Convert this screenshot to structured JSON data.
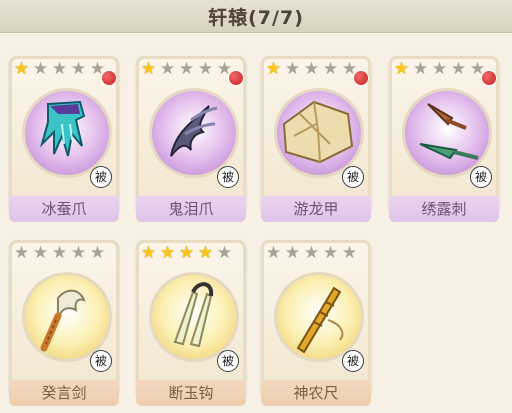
{
  "header": {
    "title": "轩辕(7/7)"
  },
  "items": [
    {
      "name": "冰蚕爪",
      "stars": 1,
      "orb": "purple",
      "passive": "被",
      "icon": "ice-silkworm-claw-icon"
    },
    {
      "name": "鬼泪爪",
      "stars": 1,
      "orb": "purple",
      "passive": "被",
      "icon": "ghost-tear-claw-icon"
    },
    {
      "name": "游龙甲",
      "stars": 1,
      "orb": "purple",
      "passive": "被",
      "icon": "dragon-armor-icon"
    },
    {
      "name": "绣露刺",
      "stars": 1,
      "orb": "purple",
      "passive": "被",
      "icon": "dew-dart-icon"
    },
    {
      "name": "癸言剑",
      "stars": 0,
      "orb": "yellow",
      "passive": "被",
      "icon": "gui-yan-sword-icon"
    },
    {
      "name": "断玉钩",
      "stars": 4,
      "orb": "yellow",
      "passive": "被",
      "icon": "jade-hook-icon"
    },
    {
      "name": "神农尺",
      "stars": 0,
      "orb": "yellow",
      "passive": "被",
      "icon": "shennong-ruler-icon"
    }
  ]
}
